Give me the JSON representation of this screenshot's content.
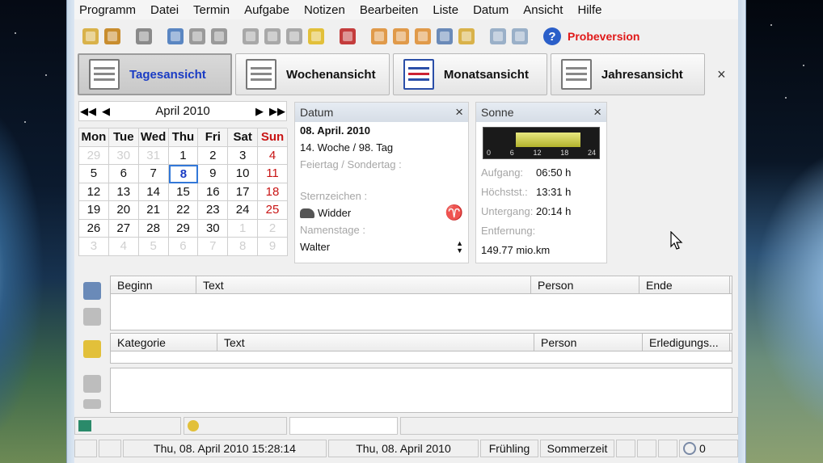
{
  "menu": [
    "Programm",
    "Datei",
    "Termin",
    "Aufgabe",
    "Notizen",
    "Bearbeiten",
    "Liste",
    "Datum",
    "Ansicht",
    "Hilfe"
  ],
  "toolbar": {
    "buttons": [
      {
        "icon": "new-appointment-icon",
        "color": "#d9b24a"
      },
      {
        "icon": "folder-icon",
        "color": "#c88d2e"
      },
      {
        "icon": "print-icon",
        "color": "#8a8a8a"
      },
      {
        "icon": "clock-icon",
        "color": "#5a86c2"
      },
      {
        "icon": "grid-icon",
        "color": "#9a9a9a"
      },
      {
        "icon": "calendar-grid-icon",
        "color": "#9a9a9a"
      },
      {
        "icon": "copy-icon",
        "color": "#a8a8a8"
      },
      {
        "icon": "undo-icon",
        "color": "#a8a8a8"
      },
      {
        "icon": "paste-icon",
        "color": "#a8a8a8"
      },
      {
        "icon": "lightbulb-icon",
        "color": "#e2c03a"
      },
      {
        "icon": "birthday-icon",
        "color": "#c43c3c"
      },
      {
        "icon": "day-sheet-icon",
        "color": "#e09a4a"
      },
      {
        "icon": "week-sheet-icon",
        "color": "#e09a4a"
      },
      {
        "icon": "month-sheet-icon",
        "color": "#e09a4a"
      },
      {
        "icon": "search-icon",
        "color": "#6a8ab8"
      },
      {
        "icon": "note-icon",
        "color": "#d9b24a"
      },
      {
        "icon": "window-icon",
        "color": "#9ab0c8"
      },
      {
        "icon": "screen-icon",
        "color": "#9ab0c8"
      }
    ],
    "help_label": "?",
    "trial_label": "Probeversion",
    "trial_color": "#e01818"
  },
  "tabs": [
    {
      "label": "Tagesansicht",
      "icon": "day-view-icon",
      "active": true
    },
    {
      "label": "Wochenansicht",
      "icon": "week-view-icon",
      "active": false
    },
    {
      "label": "Monatsansicht",
      "icon": "month-view-icon",
      "active": false
    },
    {
      "label": "Jahresansicht",
      "icon": "year-view-icon",
      "active": false
    }
  ],
  "tab_close": "×",
  "calendar": {
    "month_label": "April 2010",
    "nav": {
      "first": "◀◀",
      "prev": "◀",
      "next": "▶",
      "last": "▶▶"
    },
    "weekdays": [
      "Mon",
      "Tue",
      "Wed",
      "Thu",
      "Fri",
      "Sat",
      "Sun"
    ],
    "rows": [
      [
        "29",
        "30",
        "31",
        "1",
        "2",
        "3",
        "4"
      ],
      [
        "5",
        "6",
        "7",
        "8",
        "9",
        "10",
        "11"
      ],
      [
        "12",
        "13",
        "14",
        "15",
        "16",
        "17",
        "18"
      ],
      [
        "19",
        "20",
        "21",
        "22",
        "23",
        "24",
        "25"
      ],
      [
        "26",
        "27",
        "28",
        "29",
        "30",
        "1",
        "2"
      ],
      [
        "3",
        "4",
        "5",
        "6",
        "7",
        "8",
        "9"
      ]
    ],
    "muted": [
      [
        0,
        0
      ],
      [
        0,
        1
      ],
      [
        0,
        2
      ],
      [
        4,
        5
      ],
      [
        4,
        6
      ],
      [
        5,
        0
      ],
      [
        5,
        1
      ],
      [
        5,
        2
      ],
      [
        5,
        3
      ],
      [
        5,
        4
      ],
      [
        5,
        5
      ],
      [
        5,
        6
      ]
    ],
    "today": [
      1,
      3
    ]
  },
  "datum_panel": {
    "title": "Datum",
    "close": "×",
    "date": "08. April. 2010",
    "week": "14. Woche / 98. Tag",
    "holiday": "Feiertag / Sondertag :",
    "zodiac_label": "Sternzeichen :",
    "zodiac_value": "Widder",
    "zodiac_symbol": "♈",
    "nameday_label": "Namenstage :",
    "nameday_value": "Walter"
  },
  "sonne_panel": {
    "title": "Sonne",
    "close": "×",
    "ticks": [
      "0",
      "6",
      "12",
      "18",
      "24"
    ],
    "sunrise_label": "Aufgang:",
    "sunrise": "06:50 h",
    "noon_label": "Höchstst.:",
    "noon": "13:31 h",
    "sunset_label": "Untergang:",
    "sunset": "20:14 h",
    "distance_label": "Entfernung:",
    "distance": "149.77 mio.km"
  },
  "appointments": {
    "columns": [
      "Beginn",
      "Text",
      "Person",
      "Ende"
    ]
  },
  "tasks": {
    "columns": [
      "Kategorie",
      "Text",
      "Person",
      "Erledigungs..."
    ]
  },
  "status_bottom": {
    "datetime": "Thu, 08. April 2010 15:28:14",
    "date": "Thu, 08. April 2010",
    "season": "Frühling",
    "dst": "Sommerzeit",
    "count": "0"
  }
}
